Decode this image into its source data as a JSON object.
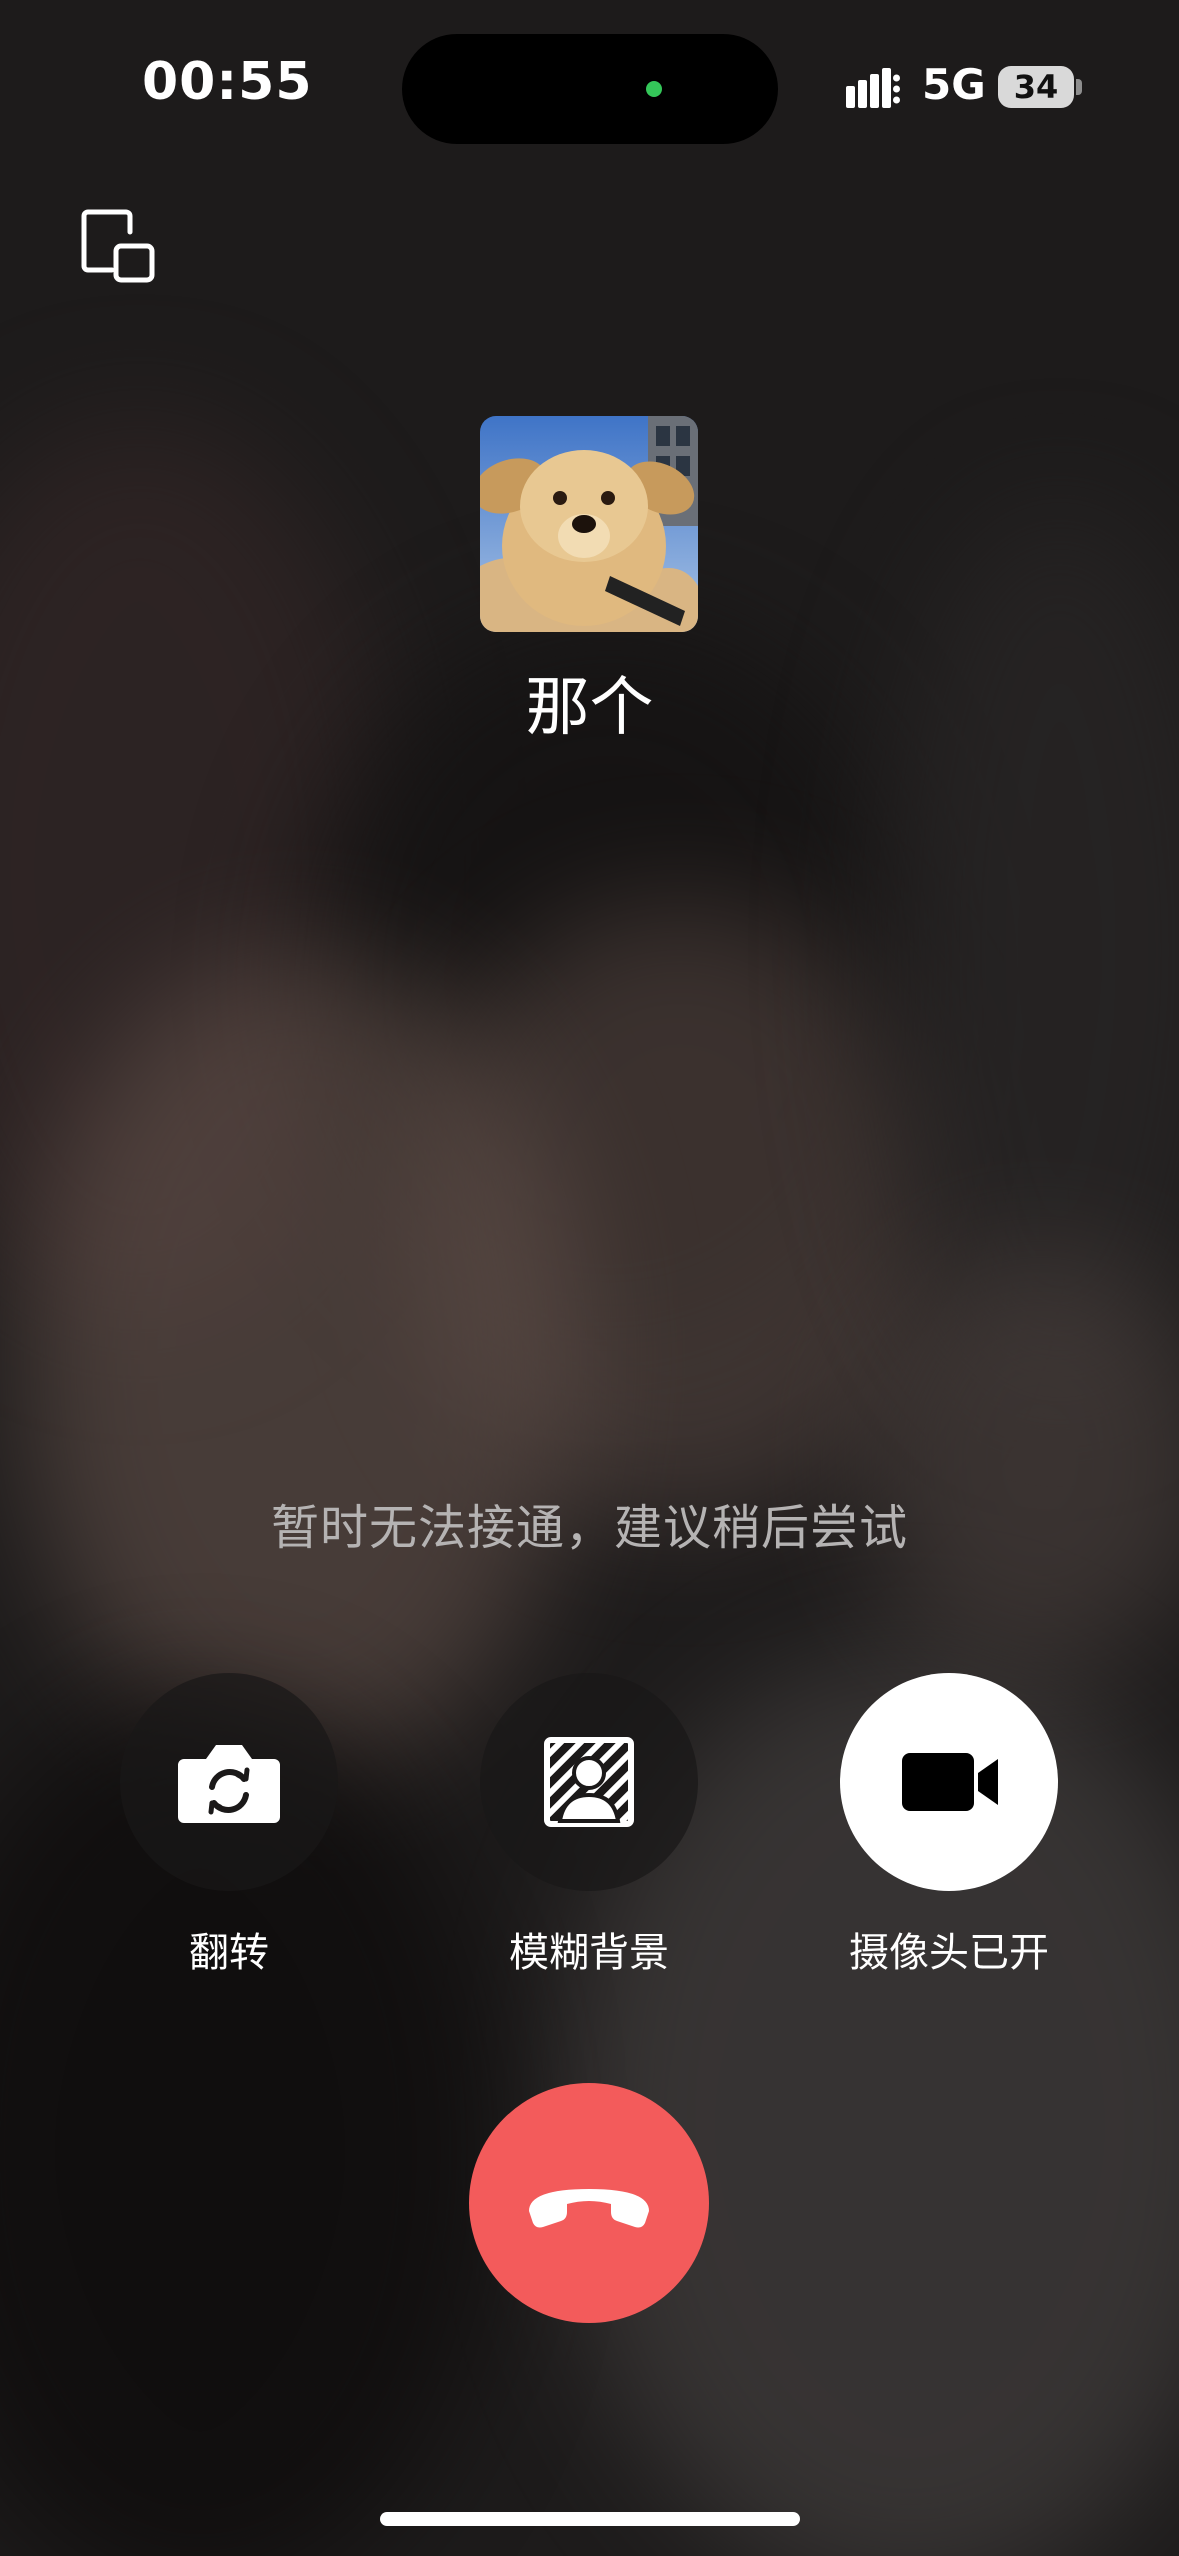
{
  "status_bar": {
    "time": "00:55",
    "network": "5G",
    "battery": "34",
    "privacy_indicator_color": "#34c759"
  },
  "call": {
    "contact_name": "那个",
    "status_message": "暂时无法接通，建议稍后尝试"
  },
  "controls": [
    {
      "label": "翻转",
      "icon": "camera-flip-icon"
    },
    {
      "label": "模糊背景",
      "icon": "blur-background-icon"
    },
    {
      "label": "摄像头已开",
      "icon": "video-camera-icon",
      "active": true
    }
  ],
  "hangup": {
    "icon": "hang-up-phone-icon",
    "color": "#f35b5b"
  },
  "icons": {
    "minimize": "picture-in-picture-icon",
    "avatar": "dog-avatar"
  }
}
